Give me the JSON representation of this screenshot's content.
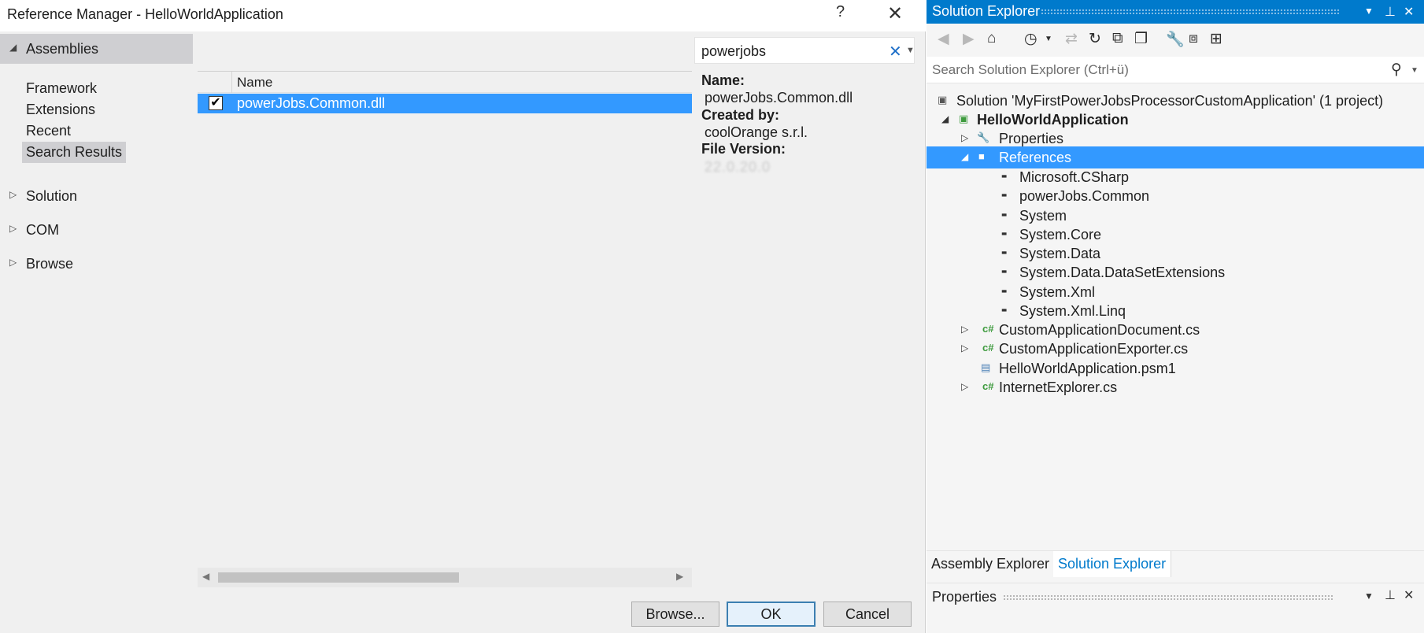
{
  "dialog": {
    "title": "Reference Manager - HelloWorldApplication",
    "help_icon": "?",
    "close_icon": "✕",
    "nav": {
      "assemblies": "Assemblies",
      "sub_items": [
        "Framework",
        "Extensions",
        "Recent",
        "Search Results"
      ],
      "solution": "Solution",
      "com": "COM",
      "browse": "Browse"
    },
    "list": {
      "column_name": "Name",
      "rows": [
        {
          "checked": true,
          "name": "powerJobs.Common.dll"
        }
      ]
    },
    "search": {
      "value": "powerjobs"
    },
    "details": {
      "name_label": "Name:",
      "name_value": "powerJobs.Common.dll",
      "created_by_label": "Created by:",
      "created_by_value": "coolOrange s.r.l.",
      "file_version_label": "File Version:",
      "file_version_value": "22.0.20.0"
    },
    "buttons": {
      "browse": "Browse...",
      "ok": "OK",
      "cancel": "Cancel"
    }
  },
  "solution_explorer": {
    "title": "Solution Explorer",
    "search_placeholder": "Search Solution Explorer (Ctrl+ü)",
    "tree": {
      "solution": "Solution 'MyFirstPowerJobsProcessorCustomApplication' (1 project)",
      "project": "HelloWorldApplication",
      "properties": "Properties",
      "references": "References",
      "reference_items": [
        "Microsoft.CSharp",
        "powerJobs.Common",
        "System",
        "System.Core",
        "System.Data",
        "System.Data.DataSetExtensions",
        "System.Xml",
        "System.Xml.Linq"
      ],
      "files": [
        {
          "name": "CustomApplicationDocument.cs",
          "icon": "cs-file-icon",
          "expandable": true
        },
        {
          "name": "CustomApplicationExporter.cs",
          "icon": "cs-file-icon",
          "expandable": true
        },
        {
          "name": "HelloWorldApplication.psm1",
          "icon": "script-file-icon",
          "expandable": false
        },
        {
          "name": "InternetExplorer.cs",
          "icon": "cs-file-icon",
          "expandable": true
        }
      ]
    },
    "tabs": {
      "assembly_explorer": "Assembly Explorer",
      "solution_explorer": "Solution Explorer"
    },
    "properties_title": "Properties"
  },
  "colors": {
    "accent": "#007acc",
    "selection": "#3399ff"
  }
}
